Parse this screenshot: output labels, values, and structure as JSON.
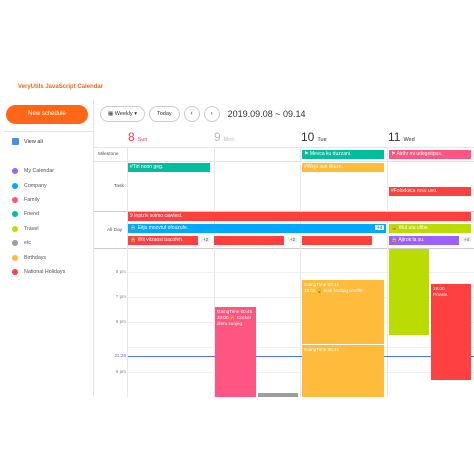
{
  "app": {
    "title": "VeryUtils JavaScript Calendar"
  },
  "sidebar": {
    "new_schedule": "New schedule",
    "view_all": "View all",
    "calendars": [
      {
        "name": "My Calendar",
        "color": "#9e5fff"
      },
      {
        "name": "Company",
        "color": "#00a9ff"
      },
      {
        "name": "Family",
        "color": "#ff5583"
      },
      {
        "name": "Friend",
        "color": "#03bd9e"
      },
      {
        "name": "Travel",
        "color": "#bbdc00"
      },
      {
        "name": "etc",
        "color": "#9d9d9d"
      },
      {
        "name": "Birthdays",
        "color": "#ffbb3b"
      },
      {
        "name": "National Holidays",
        "color": "#ff4040"
      }
    ]
  },
  "toolbar": {
    "view": "Weekly",
    "view_arrow": "▾",
    "today": "Today",
    "prev": "‹",
    "next": "›",
    "range": "2019.09.08 ~ 09.14"
  },
  "days": [
    {
      "num": "8",
      "name": "Sun",
      "color": "#ff4040"
    },
    {
      "num": "9",
      "name": "Mon",
      "color": "#bbb"
    },
    {
      "num": "10",
      "name": "Tue",
      "color": "#333"
    },
    {
      "num": "11",
      "name": "Wed",
      "color": "#333"
    }
  ],
  "rows": {
    "milestone": "Milestone",
    "task": "Task",
    "allday": "All Day"
  },
  "milestone_events": [
    {
      "text": "Mevca ku duzzani.",
      "color": "#03bd9e"
    },
    {
      "text": "Aidhr mi udegotipus.",
      "color": "#ff5583"
    }
  ],
  "task_events": [
    {
      "text": "#Tirl noon geg.",
      "color": "#03bd9e"
    },
    {
      "text": "#Wejo sun likuzo.",
      "color": "#ffbb3b"
    },
    {
      "text": "#Folodoica rosu uvo.",
      "color": "#ff4040"
    }
  ],
  "allday_events": [
    {
      "text": "9 Inpiziv soimo cawlest.",
      "color": "#ff4040"
    },
    {
      "text": "Eitju mozvtuf ofouzufe.",
      "color": "#00a9ff"
    },
    {
      "text": "Wul uta ufibe.",
      "color": "#bbdc00"
    },
    {
      "text": "Wit vitzaosi bacofeh.",
      "color": "#ff4040"
    },
    {
      "text": "Ajtrok la su.",
      "color": "#9e5fff"
    }
  ],
  "more_badges": [
    "+2",
    "+2",
    "+4",
    "+4"
  ],
  "times": [
    "8 pm",
    "7 pm",
    "6 pm",
    "9 pm",
    "21:28"
  ],
  "time_events": [
    {
      "line1": "GoingTime 00:45",
      "line2": "20:00 🔒 Cocker dieru suajeg.",
      "color": "#ff5583"
    },
    {
      "line1": "GoingTime 00:41",
      "line2": "19:00 🔒 Izek hozigig wudibr.",
      "color": "#ffbb3b"
    },
    {
      "line1": "GoingTime 00:41",
      "line2": "",
      "color": "#ffbb3b"
    },
    {
      "line1": "",
      "line2": "",
      "color": "#bbdc00"
    },
    {
      "line1": "19:00",
      "line2": "Private",
      "color": "#ff4040"
    }
  ]
}
